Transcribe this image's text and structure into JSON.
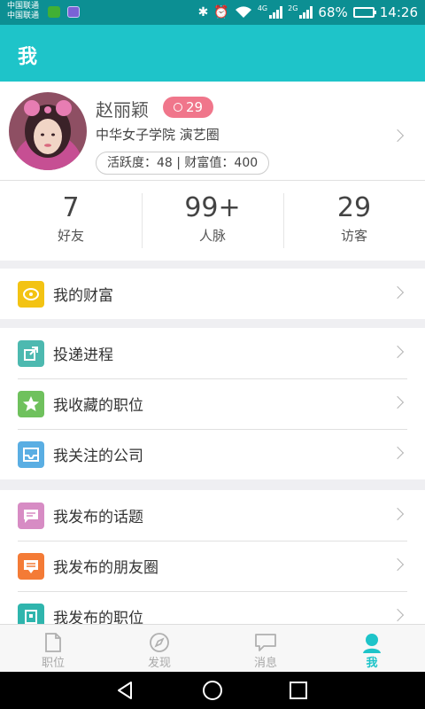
{
  "status_bar": {
    "carrier_1": "中国联通",
    "carrier_2": "中国联通",
    "net_1": "4G",
    "net_2": "2G",
    "battery": "68%",
    "battery_level": 0.68,
    "time": "14:26"
  },
  "header": {
    "title": "我"
  },
  "profile": {
    "name": "赵丽颖",
    "badge_count": "29",
    "school": "中华女子学院  演艺圈",
    "activity_text": "活跃度：48 | 财富值：400"
  },
  "stats": [
    {
      "value": "7",
      "label": "好友"
    },
    {
      "value": "99+",
      "label": "人脉"
    },
    {
      "value": "29",
      "label": "访客"
    }
  ],
  "menu": {
    "wealth": {
      "label": "我的财富",
      "icon": "coin-icon",
      "color": "#f3c313"
    },
    "progress": {
      "label": "投递进程",
      "icon": "send-arrow-icon",
      "color": "#4db9b0"
    },
    "saved_jobs": {
      "label": "我收藏的职位",
      "icon": "star-icon",
      "color": "#6fc15d"
    },
    "followed_companies": {
      "label": "我关注的公司",
      "icon": "inbox-icon",
      "color": "#5aaee3"
    },
    "my_topics": {
      "label": "我发布的话题",
      "icon": "speech-doc-icon",
      "color": "#d78cc4"
    },
    "my_moments": {
      "label": "我发布的朋友圈",
      "icon": "chat-lines-icon",
      "color": "#f47b36"
    },
    "my_jobs": {
      "label": "我发布的职位",
      "icon": "briefcase-icon",
      "color": "#2fb5ad"
    }
  },
  "tabbar": [
    {
      "label": "职位",
      "icon": "document-icon"
    },
    {
      "label": "发现",
      "icon": "compass-icon"
    },
    {
      "label": "消息",
      "icon": "chat-bubble-icon"
    },
    {
      "label": "我",
      "icon": "person-icon"
    }
  ],
  "colors": {
    "accent": "#1ec4c9",
    "status_bar": "#0c8f93",
    "badge": "#f0768b"
  }
}
